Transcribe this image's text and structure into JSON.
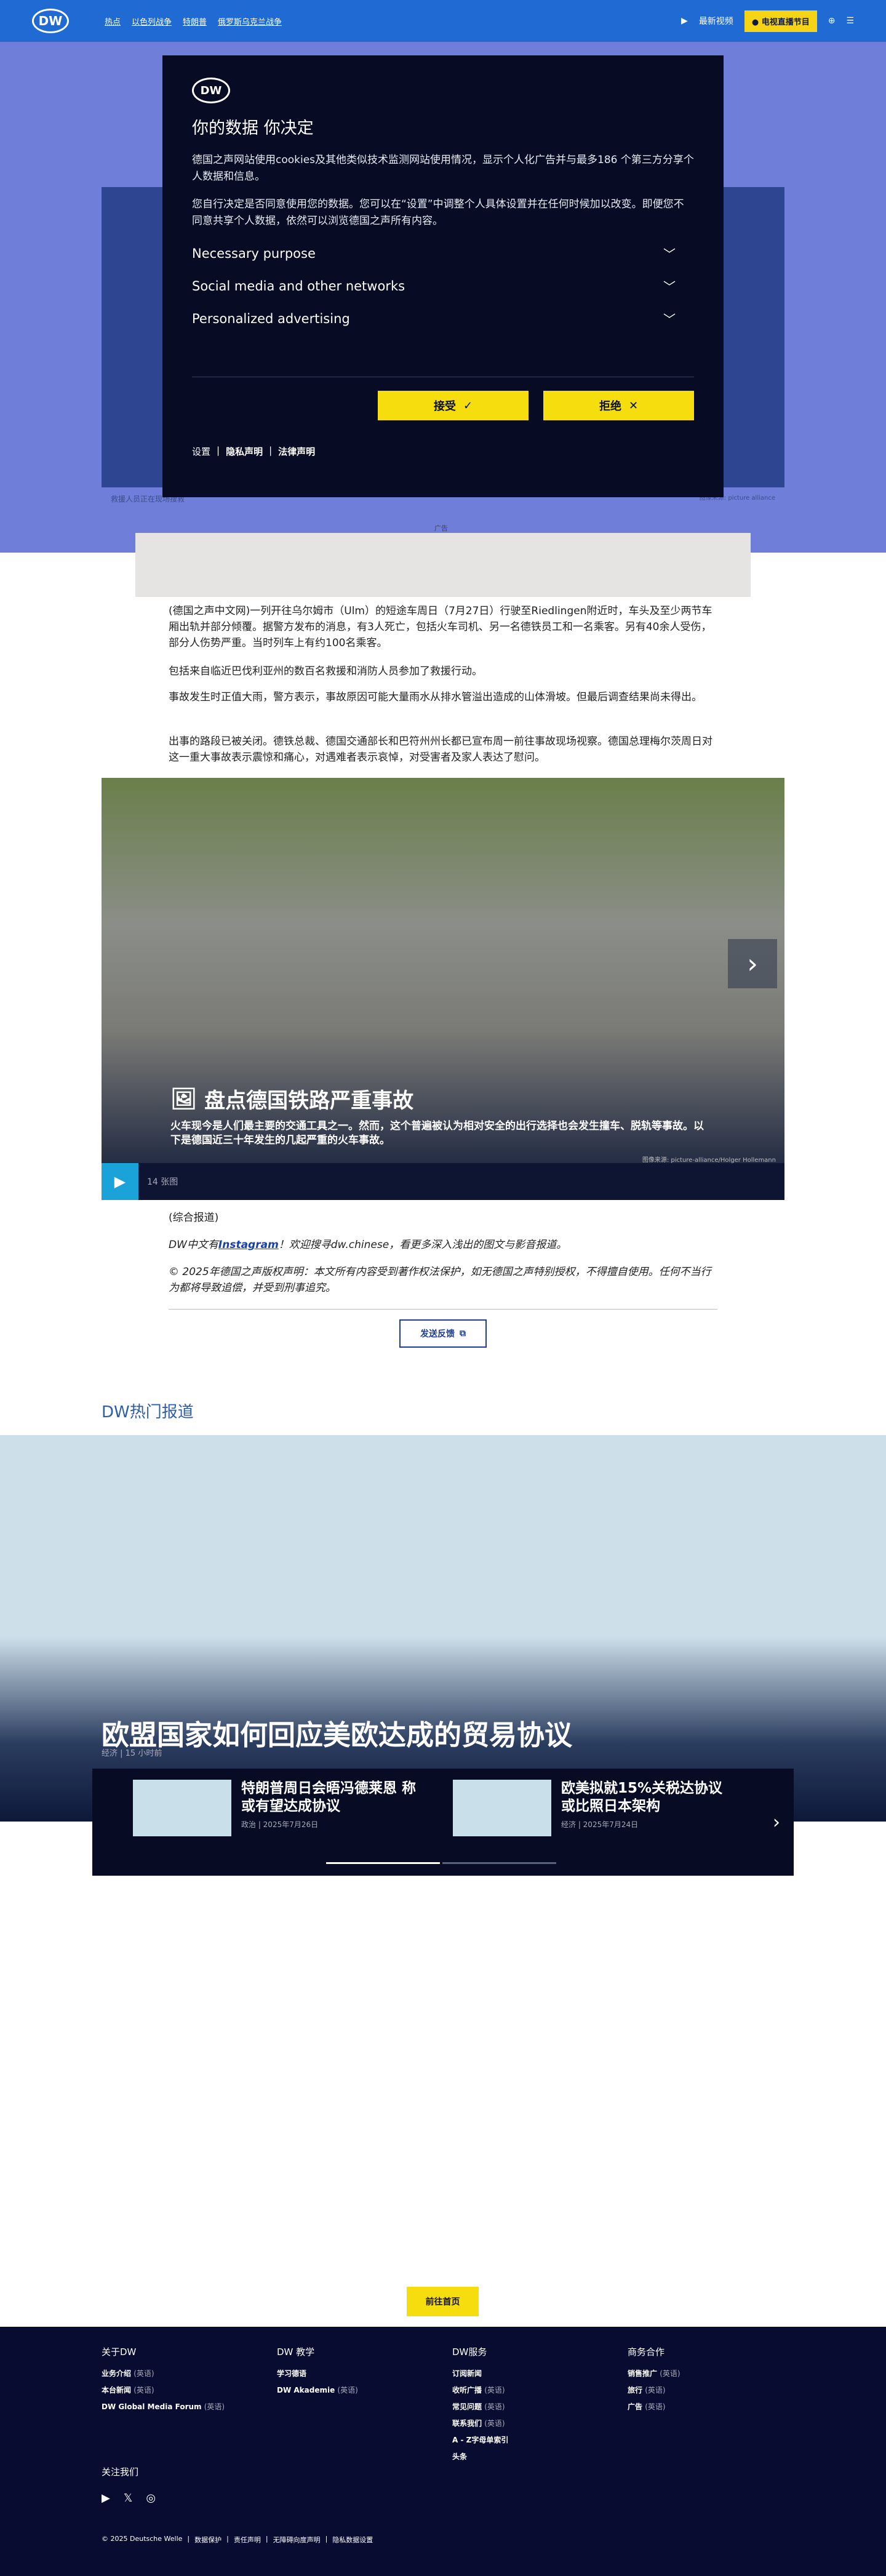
{
  "header": {
    "logo": "DW",
    "nav": [
      "热点",
      "以色列战争",
      "特朗普",
      "俄罗斯乌克兰战争"
    ],
    "latest": "最新视频",
    "tv": "电视直播节目"
  },
  "hero": {
    "caption": "救援人员正在现场搜救",
    "credit": "图像来源: picture alliance"
  },
  "consent": {
    "logo": "DW",
    "title": "你的数据 你决定",
    "text1": "德国之声网站使用cookies及其他类似技术监测网站使用情况，显示个人化广告并与最多186 个第三方分享个人数据和信息。",
    "text2": "您自行决定是否同意使用您的数据。您可以在“设置”中调整个人具体设置并在任何时候加以改变。即便您不同意共享个人数据，依然可以浏览德国之声所有内容。",
    "sections": [
      "Necessary purpose",
      "Social media and other networks",
      "Personalized advertising"
    ],
    "accept": "接受",
    "accept_icon": "✓",
    "reject": "拒绝",
    "reject_icon": "✕",
    "links": [
      "设置",
      "隐私声明",
      "法律声明"
    ]
  },
  "ad": {
    "label": "广告"
  },
  "article": {
    "p1": "(德国之声中文网)一列开往乌尔姆市（Ulm）的短途车周日（7月27日）行驶至Riedlingen附近时，车头及至少两节车厢出轨并部分倾覆。据警方发布的消息，有3人死亡，包括火车司机、另一名德铁员工和一名乘客。另有40余人受伤，部分人伤势严重。当时列车上有约100名乘客。",
    "p2": "包括来自临近巴伐利亚州的数百名救援和消防人员参加了救援行动。",
    "p3": "事故发生时正值大雨，警方表示，事故原因可能大量雨水从排水管溢出造成的山体滑坡。但最后调查结果尚未得出。",
    "p4": "出事的路段已被关闭。德铁总裁、德国交通部长和巴符州州长都已宣布周一前往事故现场视察。德国总理梅尔茨周日对这一重大事故表示震惊和痛心，对遇难者表示哀悼，对受害者及家人表达了慰问。"
  },
  "gallery": {
    "title": "盘点德国铁路严重事故",
    "description": "火车现今是人们最主要的交通工具之一。然而，这个普遍被认为相对安全的出行选择也会发生撞车、脱轨等事故。以下是德国近三十年发生的几起严重的火车事故。",
    "credit": "图像来源: picture-alliance/Holger Hollemann",
    "count": "14 张图"
  },
  "source": "(综合报道)",
  "note1_pre": "DW中文有",
  "note1_link": "Instagram",
  "note1_post": "！欢迎搜寻dw.chinese，看更多深入浅出的图文与影音报道。",
  "note2": "© 2025年德国之声版权声明：本文所有内容受到著作权法保护，如无德国之声特别授权，不得擅自使用。任何不当行为都将导致追偿，并受到刑事追究。",
  "feedback": "发送反馈",
  "trending": {
    "title": "DW热门报道",
    "headline": "欧盟国家如何回应美欧达成的贸易协议",
    "meta": "经济 | 15 小时前",
    "cards": [
      {
        "title": "特朗普周日会晤冯德莱恩 称或有望达成协议",
        "meta": "政治 | 2025年7月26日"
      },
      {
        "title": "欧美拟就15%关税达协议　或比照日本架构",
        "meta": "经济 | 2025年7月24日"
      }
    ]
  },
  "home_button": "前往首页",
  "footer": {
    "cols": [
      {
        "title": "关于DW",
        "items": [
          [
            "业务介绍",
            "(英语)"
          ],
          [
            "本台新闻",
            "(英语)"
          ],
          [
            "DW Global Media Forum",
            "(英语)"
          ]
        ]
      },
      {
        "title": "DW 教学",
        "items": [
          [
            "学习德语",
            ""
          ],
          [
            "DW Akademie",
            "(英语)"
          ]
        ]
      },
      {
        "title": "DW服务",
        "items": [
          [
            "订阅新闻",
            ""
          ],
          [
            "收听广播",
            "(英语)"
          ],
          [
            "常见问题",
            "(英语)"
          ],
          [
            "联系我们",
            "(英语)"
          ],
          [
            "A - Z字母单索引",
            ""
          ],
          [
            "头条",
            ""
          ]
        ]
      },
      {
        "title": "商务合作",
        "items": [
          [
            "销售推广",
            "(英语)"
          ],
          [
            "旅行",
            "(英语)"
          ],
          [
            "广告",
            "(英语)"
          ]
        ]
      }
    ],
    "follow": "关注我们",
    "social": [
      "youtube-icon",
      "x-icon",
      "instagram-icon"
    ],
    "copyright": [
      "© 2025 Deutsche Welle",
      "数据保护",
      "责任声明",
      "无障碍向度声明",
      "隐私数据设置"
    ]
  }
}
